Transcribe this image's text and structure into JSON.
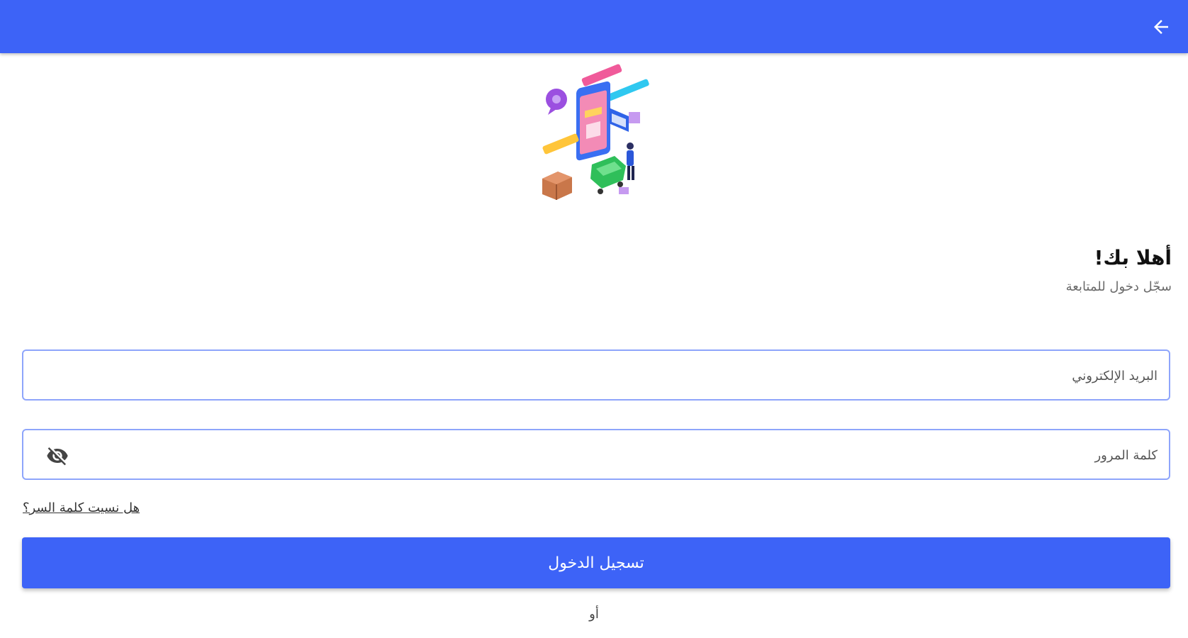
{
  "appbar": {
    "back_icon": "arrow-back-icon",
    "color": "#3d63f7"
  },
  "hero": {
    "illustration": "shopping-illustration"
  },
  "welcome": {
    "title": "أهلا بك!",
    "subtitle": "سجّل دخول للمتابعة"
  },
  "form": {
    "email": {
      "placeholder": "البريد الإلكتروني",
      "value": ""
    },
    "password": {
      "placeholder": "كلمة المرور",
      "value": "",
      "toggle_icon": "eye-off-icon"
    },
    "forgot_password": "هل نسيت كلمة السر؟",
    "login_button": "تسجيل الدخول",
    "or_text": "أو"
  },
  "colors": {
    "primary": "#3d63f7",
    "field_border": "#8ea5fb"
  }
}
